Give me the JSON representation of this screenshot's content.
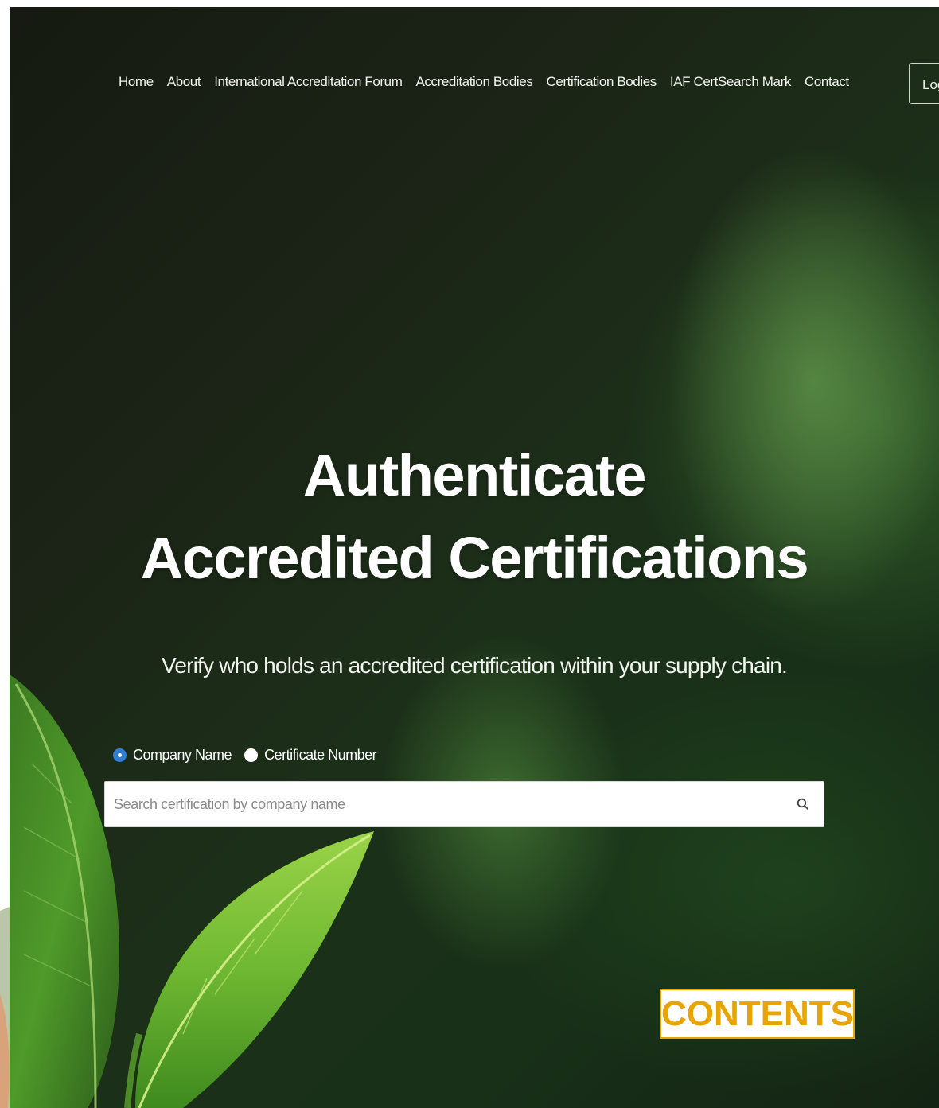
{
  "nav": {
    "items": [
      {
        "label": "Home"
      },
      {
        "label": "About"
      },
      {
        "label": "International Accreditation Forum"
      },
      {
        "label": "Accreditation Bodies"
      },
      {
        "label": "Certification Bodies"
      },
      {
        "label": "IAF CertSearch Mark"
      },
      {
        "label": "Contact"
      }
    ],
    "login_label": "Log"
  },
  "hero": {
    "title_line1": "Authenticate",
    "title_line2": "Accredited Certifications",
    "subtitle": "Verify who holds an accredited certification within your supply chain."
  },
  "search": {
    "options": [
      {
        "label": "Company Name",
        "selected": true
      },
      {
        "label": "Certificate Number",
        "selected": false
      }
    ],
    "placeholder": "Search certification by company name",
    "value": ""
  },
  "badge": {
    "label": "CONTENTS"
  },
  "colors": {
    "accent_radio": "#2f7fd6",
    "badge": "#e8a400",
    "background_dark": "#1b2416",
    "leaf_green": "#5fa832"
  }
}
